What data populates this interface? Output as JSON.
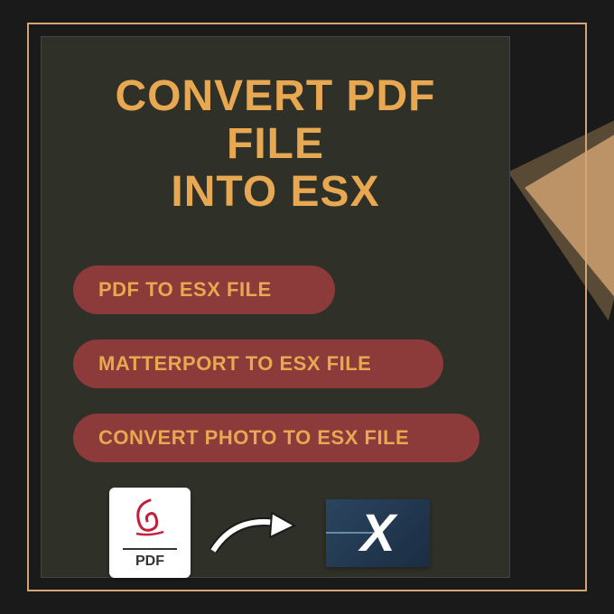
{
  "title": {
    "line1": "CONVERT PDF FILE",
    "line2": "INTO ESX"
  },
  "pills": [
    "PDF TO ESX FILE",
    "MATTERPORT TO ESX FILE",
    "CONVERT PHOTO TO ESX FILE"
  ],
  "icons": {
    "pdf_label": "PDF",
    "esx_label": "X"
  },
  "colors": {
    "accent": "#e8a751",
    "pill_bg": "#8c3a3a",
    "frame": "#d4a574",
    "inner_bg": "#2f3028"
  }
}
